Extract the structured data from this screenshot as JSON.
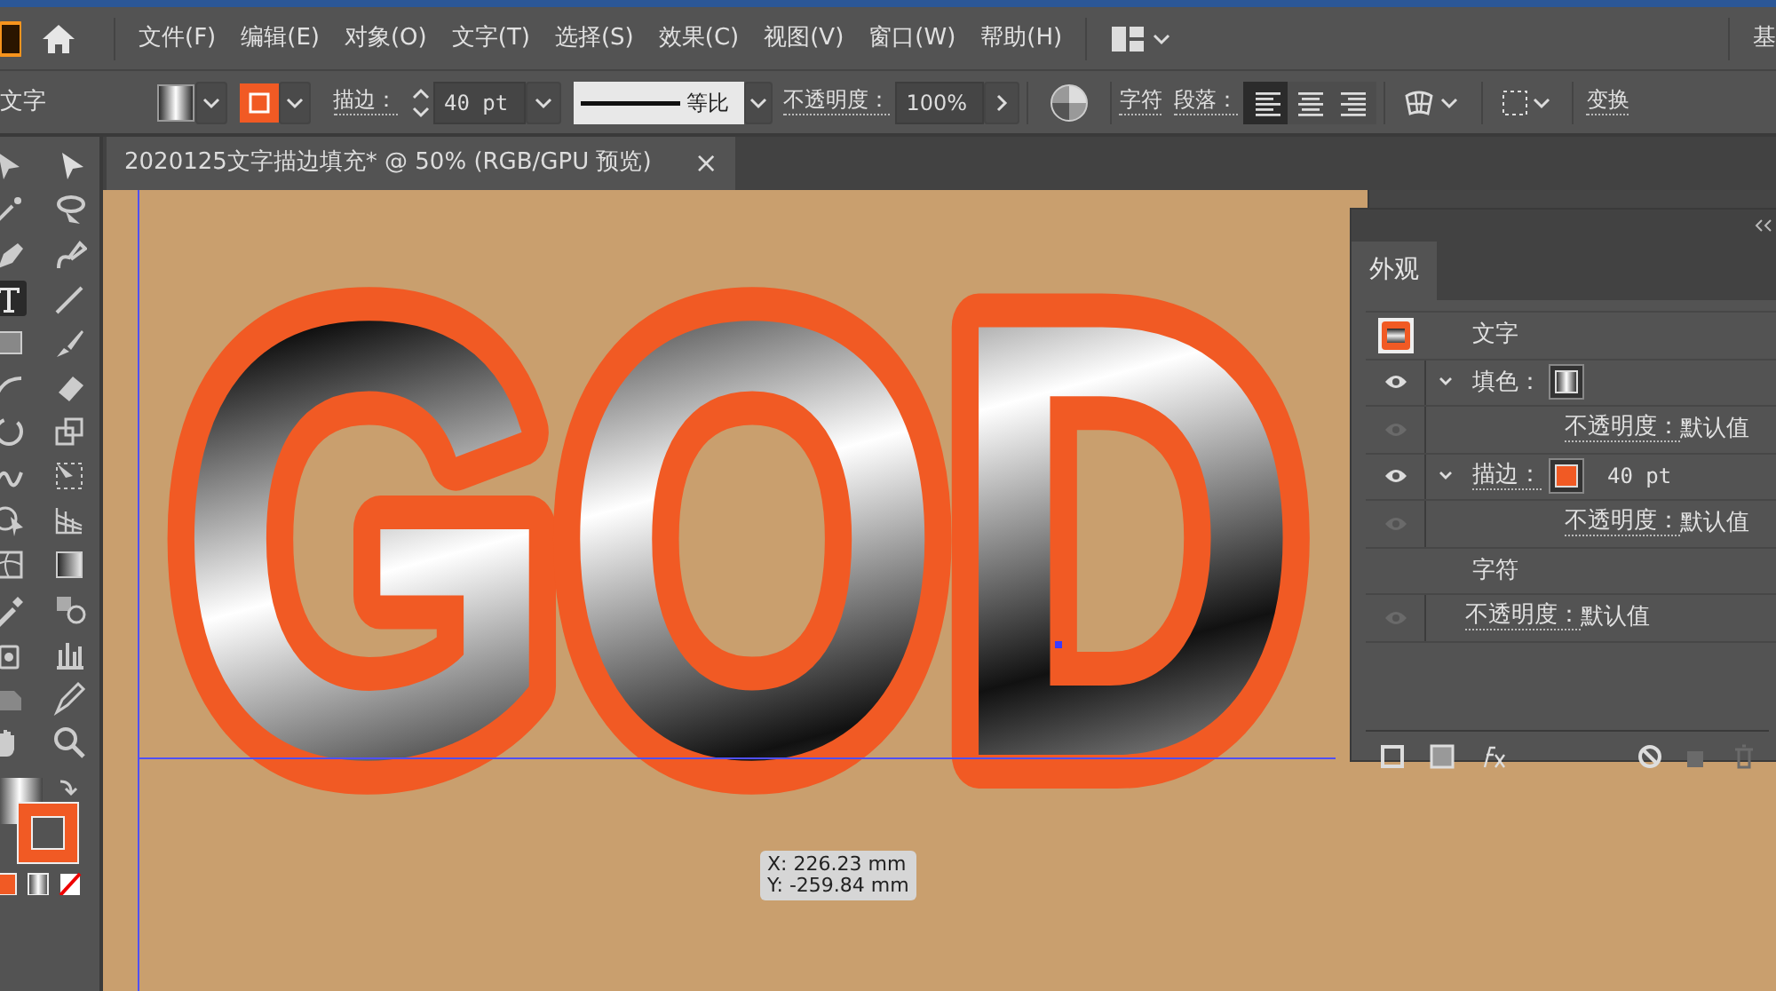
{
  "menu_bar": {
    "menus": [
      "文件(F)",
      "编辑(E)",
      "对象(O)",
      "文字(T)",
      "选择(S)",
      "效果(C)",
      "视图(V)",
      "窗口(W)",
      "帮助(H)"
    ],
    "workspace": "基"
  },
  "control_bar": {
    "selection": "文字",
    "stroke_label": "描边：",
    "stroke_weight": "40 pt",
    "stroke_profile": "等比",
    "opacity_label": "不透明度：",
    "opacity": "100%",
    "character": "字符",
    "paragraph": "段落：",
    "align": [
      {
        "selected": true
      },
      {
        "selected": false
      },
      {
        "selected": false
      }
    ],
    "transform": "变换"
  },
  "document_tab": {
    "title": "2020125文字描边填充* @ 50% (RGB/GPU 预览)",
    "close": "×"
  },
  "canvas": {
    "artwork_text": "GOD",
    "tooltip": [
      "X: 226.23 mm",
      "Y: -259.84 mm"
    ]
  },
  "appearance_panel": {
    "tab": "外观",
    "rows": [
      {
        "kind": "object",
        "label": "文字"
      },
      {
        "kind": "fill",
        "label": "填色：",
        "visible": true,
        "expanded": true,
        "children": [
          {
            "kind": "opacity",
            "label": "不透明度：",
            "value": "默认值",
            "visible": false
          }
        ]
      },
      {
        "kind": "stroke",
        "label": "描边：",
        "value": "40 pt",
        "visible": true,
        "expanded": true,
        "children": [
          {
            "kind": "opacity",
            "label": "不透明度：",
            "value": "默认值",
            "visible": false
          }
        ]
      },
      {
        "kind": "group",
        "label": "字符"
      },
      {
        "kind": "opacity",
        "label": "不透明度：",
        "value": "默认值",
        "visible": false
      }
    ]
  }
}
